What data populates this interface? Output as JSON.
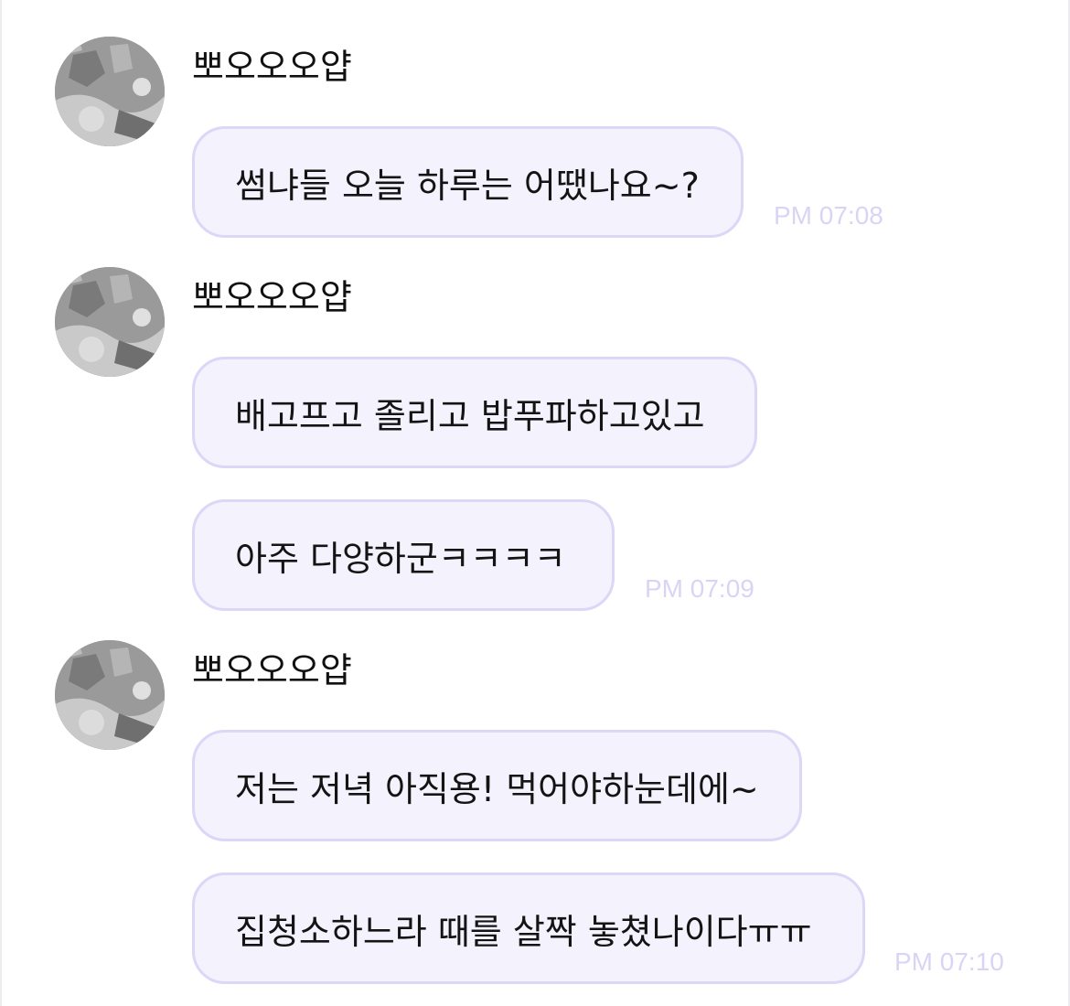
{
  "groups": [
    {
      "sender": "뽀오오오얍",
      "avatar_icon": "profile-photo",
      "messages": [
        "썸냐들 오늘 하루는 어땠나요~?"
      ],
      "time": "PM 07:08"
    },
    {
      "sender": "뽀오오오얍",
      "avatar_icon": "profile-photo",
      "messages": [
        "배고프고 졸리고 밥푸파하고있고",
        "아주 다양하군ㅋㅋㅋㅋ"
      ],
      "time": "PM 07:09"
    },
    {
      "sender": "뽀오오오얍",
      "avatar_icon": "profile-photo",
      "messages": [
        "저는 저녁 아직용! 먹어야하눈데에~",
        "집청소하느라 때를 살짝 놓쳤나이다ㅠㅠ"
      ],
      "time": "PM 07:10"
    }
  ],
  "colors": {
    "bubble_bg": "#f3f2fd",
    "bubble_border": "#dcd6f7",
    "timestamp": "#d9d4f5",
    "text": "#141414"
  }
}
